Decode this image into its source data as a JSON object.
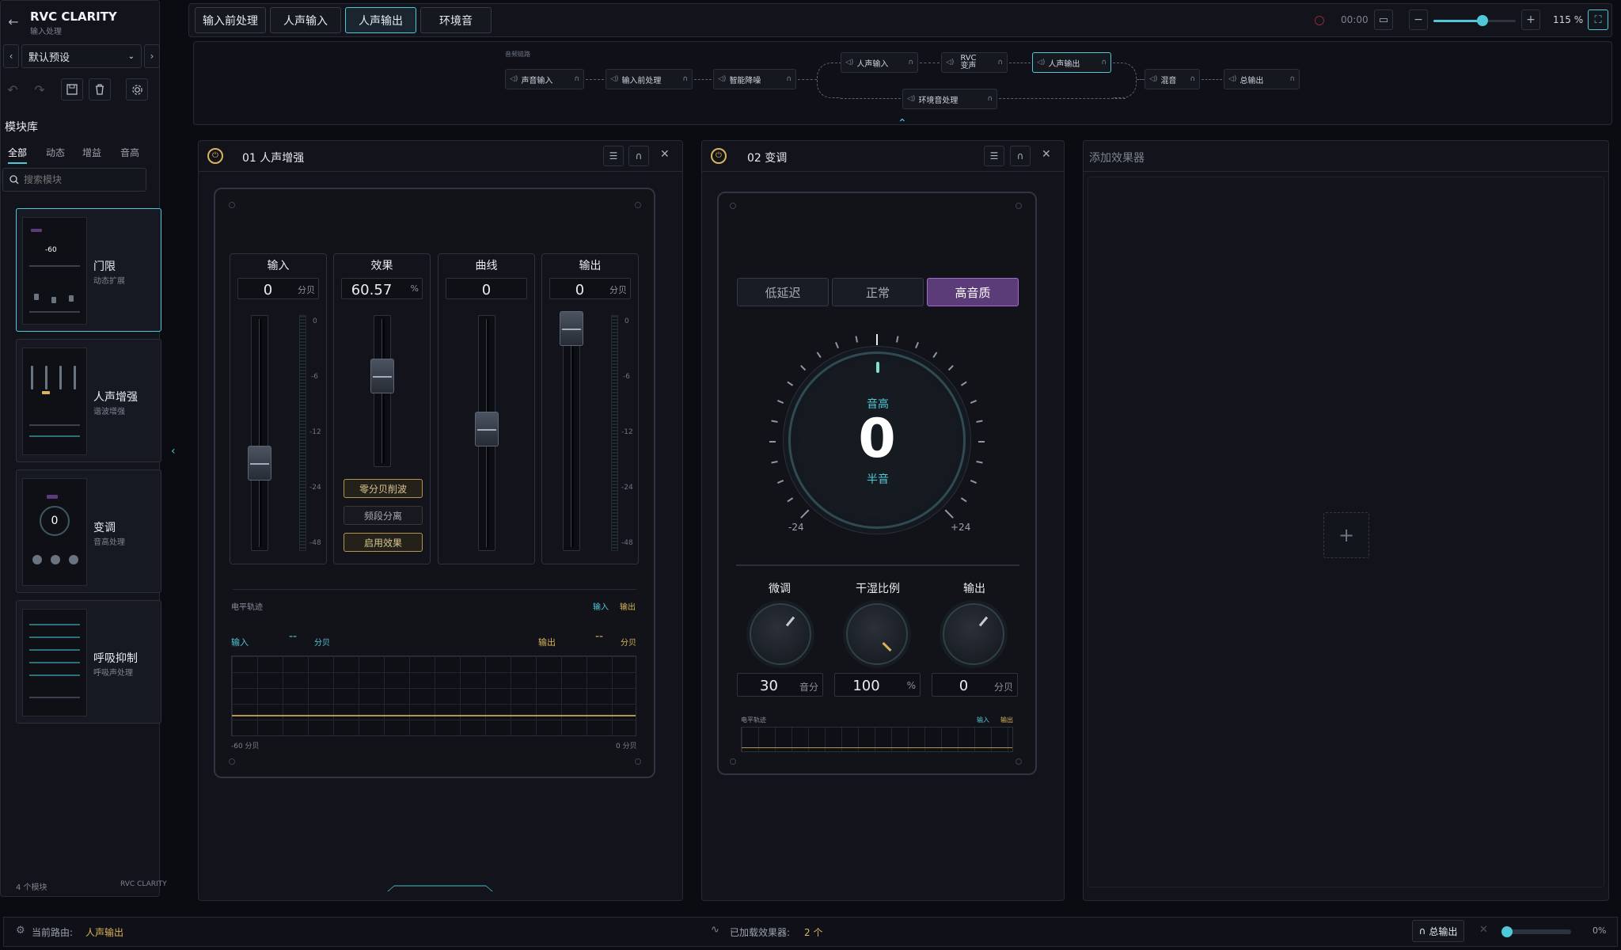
{
  "app": {
    "title": "RVC CLARITY",
    "subtitle": "输入处理"
  },
  "sidebar": {
    "preset": "默认预设",
    "library_title": "模块库",
    "filters": [
      "全部",
      "动态",
      "增益",
      "音高"
    ],
    "search_placeholder": "搜索模块",
    "modules": [
      {
        "name": "门限",
        "desc": "动态扩展"
      },
      {
        "name": "人声增强",
        "desc": "谐波增强"
      },
      {
        "name": "变调",
        "desc": "音高处理"
      },
      {
        "name": "呼吸抑制",
        "desc": "呼吸声处理"
      }
    ],
    "footer_count": "4 个模块",
    "footer_brand": "RVC CLARITY"
  },
  "tabs": [
    "输入前处理",
    "人声输入",
    "人声输出",
    "环境音"
  ],
  "toolbar": {
    "time": "00:00",
    "zoom": "115 %",
    "zoom_level": 0.6
  },
  "routing": {
    "label": "音频链路",
    "nodes": [
      "声音输入",
      "输入前处理",
      "智能降噪",
      "人声输入",
      "RVC 变声",
      "人声输出",
      "混音",
      "总输出",
      "环境音处理"
    ]
  },
  "effect1": {
    "title": "01 人声增强",
    "channels": [
      {
        "label": "输入",
        "value": "0",
        "unit": "分贝"
      },
      {
        "label": "效果",
        "value": "60.57",
        "unit": "%"
      },
      {
        "label": "曲线",
        "value": "0",
        "unit": ""
      },
      {
        "label": "输出",
        "value": "0",
        "unit": "分贝"
      }
    ],
    "scale": [
      "0",
      "-6",
      "-12",
      "-24",
      "-48"
    ],
    "buttons": [
      "零分贝削波",
      "频段分离",
      "启用效果"
    ],
    "trace": {
      "title": "电平轨迹",
      "legend_in": "输入",
      "legend_out": "输出",
      "in_label": "输入",
      "in_value": "--",
      "in_unit": "分贝",
      "out_label": "输出",
      "out_value": "--",
      "out_unit": "分贝",
      "x_min": "-60 分贝",
      "x_max": "0 分贝"
    }
  },
  "effect2": {
    "title": "02 变调",
    "modes": [
      "低延迟",
      "正常",
      "高音质"
    ],
    "active_mode": "高音质",
    "dial": {
      "label": "音高",
      "value": "0",
      "unit": "半音",
      "min": "-24",
      "max": "+24"
    },
    "knobs": [
      {
        "label": "微调",
        "value": "30",
        "unit": "音分"
      },
      {
        "label": "干湿比例",
        "value": "100",
        "unit": "%"
      },
      {
        "label": "输出",
        "value": "0",
        "unit": "分贝"
      }
    ],
    "trace": {
      "title": "电平轨迹",
      "legend_in": "输入",
      "legend_out": "输出"
    }
  },
  "effect3": {
    "title": "添加效果器",
    "add_symbol": "+"
  },
  "statusbar": {
    "route_label": "当前路由:",
    "route_value": "人声输出",
    "loaded_label": "已加载效果器:",
    "loaded_value": "2 个",
    "master_label": "总输出",
    "master_level": "0%"
  },
  "colors": {
    "accent": "#4fc8d8",
    "gold": "#d9b45a",
    "purple": "#5b3b78"
  }
}
